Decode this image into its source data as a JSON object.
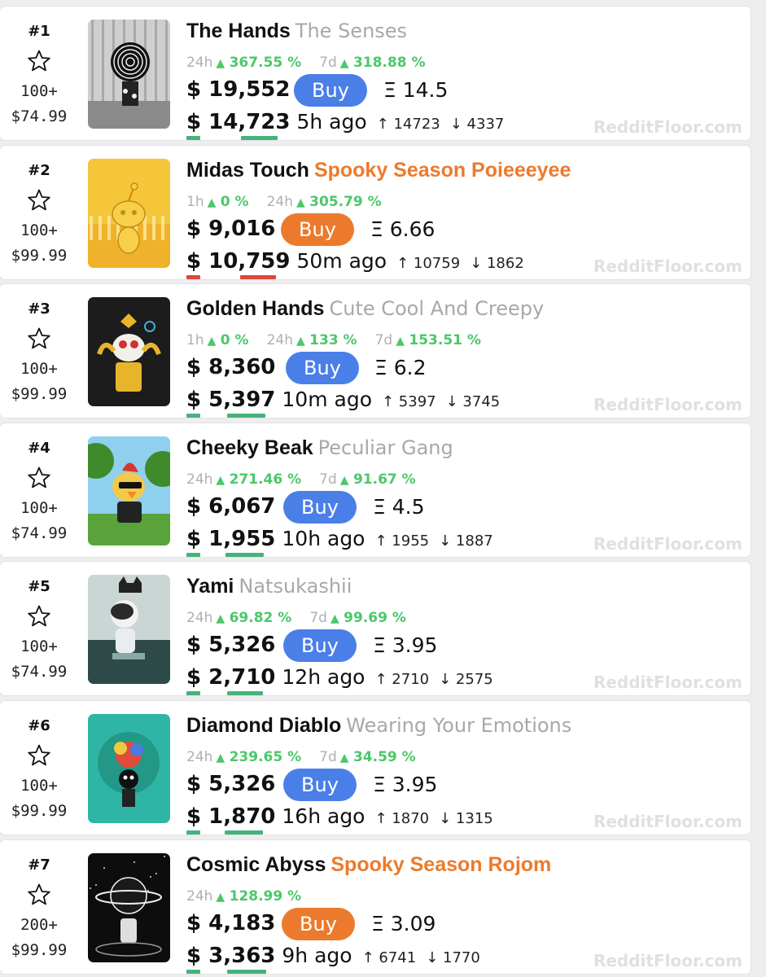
{
  "colors": {
    "green": "#4cc76a",
    "blue_button": "#4b7fe8",
    "orange_button": "#ec7a2c",
    "orange_text": "#ec7a2c",
    "red_underline": "#e0453c",
    "green_underline": "#45b37a",
    "muted": "#a8a8ac"
  },
  "icons": {
    "star": "star-outline-icon",
    "up_triangle": "triangle-up-icon",
    "up_arrow": "arrow-up-icon",
    "down_arrow": "arrow-down-icon"
  },
  "watermark": "RedditFloor.com",
  "items": [
    {
      "rank": "#1",
      "supply": "100+",
      "mint_price": "$74.99",
      "name": "The Hands",
      "collection": "The Senses",
      "collection_style": "muted",
      "changes": [
        {
          "period": "24h",
          "arrow": "▲",
          "pct": "367.55 %"
        },
        {
          "period": "7d",
          "arrow": "▲",
          "pct": "318.88 %"
        }
      ],
      "volume": "$ 19,552",
      "buy_label": "Buy",
      "buy_color": "blue",
      "eth": "Ξ 14.5",
      "last_price": "$ 14,723",
      "underline": "green",
      "ago": "5h ago",
      "up": "↑ 14723",
      "down": "↓ 4337",
      "art": "hands-monochrome"
    },
    {
      "rank": "#2",
      "supply": "100+",
      "mint_price": "$99.99",
      "name": "Midas Touch",
      "collection": "Spooky Season Poieeeyee",
      "collection_style": "orange",
      "changes": [
        {
          "period": "1h",
          "arrow": "▲",
          "pct": "0 %"
        },
        {
          "period": "24h",
          "arrow": "▲",
          "pct": "305.79 %"
        }
      ],
      "volume": "$ 9,016",
      "buy_label": "Buy",
      "buy_color": "orange",
      "eth": "Ξ 6.66",
      "last_price": "$ 10,759",
      "underline": "red",
      "ago": "50m ago",
      "up": "↑ 10759",
      "down": "↓ 1862",
      "art": "golden-snoo"
    },
    {
      "rank": "#3",
      "supply": "100+",
      "mint_price": "$99.99",
      "name": "Golden Hands",
      "collection": "Cute Cool And Creepy",
      "collection_style": "muted",
      "changes": [
        {
          "period": "1h",
          "arrow": "▲",
          "pct": "0 %"
        },
        {
          "period": "24h",
          "arrow": "▲",
          "pct": "133 %"
        },
        {
          "period": "7d",
          "arrow": "▲",
          "pct": "153.51 %"
        }
      ],
      "volume": "$ 8,360",
      "buy_label": "Buy",
      "buy_color": "blue",
      "eth": "Ξ 6.2",
      "last_price": "$ 5,397",
      "underline": "green",
      "ago": "10m ago",
      "up": "↑ 5397",
      "down": "↓ 3745",
      "art": "golden-jester"
    },
    {
      "rank": "#4",
      "supply": "100+",
      "mint_price": "$74.99",
      "name": "Cheeky Beak",
      "collection": "Peculiar Gang",
      "collection_style": "muted",
      "changes": [
        {
          "period": "24h",
          "arrow": "▲",
          "pct": "271.46 %"
        },
        {
          "period": "7d",
          "arrow": "▲",
          "pct": "91.67 %"
        }
      ],
      "volume": "$ 6,067",
      "buy_label": "Buy",
      "buy_color": "blue",
      "eth": "Ξ 4.5",
      "last_price": "$ 1,955",
      "underline": "green",
      "ago": "10h ago",
      "up": "↑ 1955",
      "down": "↓ 1887",
      "art": "rooster-forest"
    },
    {
      "rank": "#5",
      "supply": "100+",
      "mint_price": "$74.99",
      "name": "Yami",
      "collection": "Natsukashii",
      "collection_style": "muted",
      "changes": [
        {
          "period": "24h",
          "arrow": "▲",
          "pct": "69.82 %"
        },
        {
          "period": "7d",
          "arrow": "▲",
          "pct": "99.69 %"
        }
      ],
      "volume": "$ 5,326",
      "buy_label": "Buy",
      "buy_color": "blue",
      "eth": "Ξ 3.95",
      "last_price": "$ 2,710",
      "underline": "green",
      "ago": "12h ago",
      "up": "↑ 2710",
      "down": "↓ 2575",
      "art": "teal-cat"
    },
    {
      "rank": "#6",
      "supply": "100+",
      "mint_price": "$99.99",
      "name": "Diamond Diablo",
      "collection": "Wearing Your Emotions",
      "collection_style": "muted",
      "changes": [
        {
          "period": "24h",
          "arrow": "▲",
          "pct": "239.65 %"
        },
        {
          "period": "7d",
          "arrow": "▲",
          "pct": "34.59 %"
        }
      ],
      "volume": "$ 5,326",
      "buy_label": "Buy",
      "buy_color": "blue",
      "eth": "Ξ 3.95",
      "last_price": "$ 1,870",
      "underline": "green",
      "ago": "16h ago",
      "up": "↑ 1870",
      "down": "↓ 1315",
      "art": "teal-diablo"
    },
    {
      "rank": "#7",
      "supply": "200+",
      "mint_price": "$99.99",
      "name": "Cosmic Abyss",
      "collection": "Spooky Season Rojom",
      "collection_style": "orange",
      "changes": [
        {
          "period": "24h",
          "arrow": "▲",
          "pct": "128.99 %"
        }
      ],
      "volume": "$ 4,183",
      "buy_label": "Buy",
      "buy_color": "orange",
      "eth": "Ξ 3.09",
      "last_price": "$ 3,363",
      "underline": "green",
      "ago": "9h ago",
      "up": "↑ 6741",
      "down": "↓ 1770",
      "art": "cosmic-planet"
    }
  ]
}
